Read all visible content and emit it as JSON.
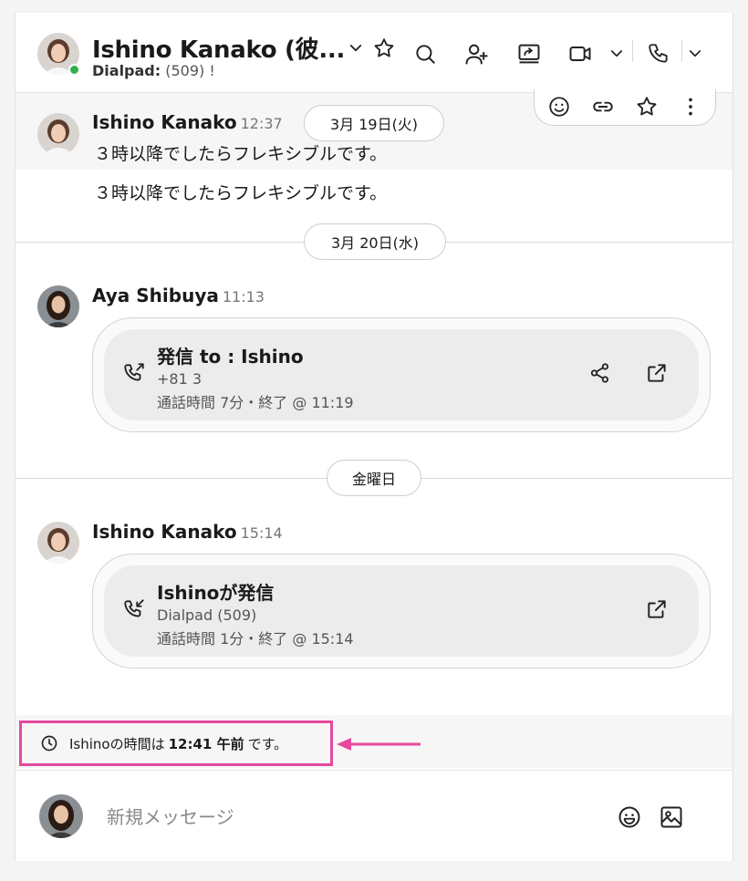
{
  "header": {
    "contact_name": "Ishino Kanako (彼...",
    "sub_label": "Dialpad:",
    "sub_value": "(509) !",
    "presence": "online",
    "icons": [
      "chevron-down-icon",
      "star-icon",
      "search-icon",
      "add-person-icon",
      "screen-share-icon",
      "video-icon",
      "chevron-down-icon",
      "phone-icon",
      "chevron-down-icon"
    ]
  },
  "messages": [
    {
      "sender": "Ishino Kanako",
      "time": "12:37",
      "lines": [
        "３時以降でしたらフレキシブルです。",
        "３時以降でしたらフレキシブルです。"
      ]
    }
  ],
  "hover_toolbar": [
    "smile-icon",
    "link-icon",
    "star-icon",
    "more-vertical-icon"
  ],
  "date_separators": [
    "3月 19日(火)",
    "3月 20日(水)",
    "金曜日"
  ],
  "calls": [
    {
      "sender": "Aya Shibuya",
      "time": "11:13",
      "title": "発信 to : Ishino",
      "line1": "+81 3",
      "line2": "通話時間 7分・終了 @ 11:19",
      "direction_icon": "outgoing-call-icon",
      "actions": [
        "share-icon",
        "open-external-icon"
      ]
    },
    {
      "sender": "Ishino Kanako",
      "time": "15:14",
      "title": "Ishinoが発信",
      "line1": "Dialpad (509)",
      "line2": "通話時間 1分・終了 @ 15:14",
      "direction_icon": "incoming-call-icon",
      "actions": [
        "open-external-icon"
      ]
    }
  ],
  "timezone_notice": {
    "prefix": "Ishinoの時間は",
    "time": "12:41 午前",
    "suffix": "です。"
  },
  "composer": {
    "placeholder": "新規メッセージ",
    "icons": [
      "emoji-icon",
      "image-icon"
    ]
  },
  "colors": {
    "presence": "#2fb24a",
    "highlight": "#e5499d"
  }
}
